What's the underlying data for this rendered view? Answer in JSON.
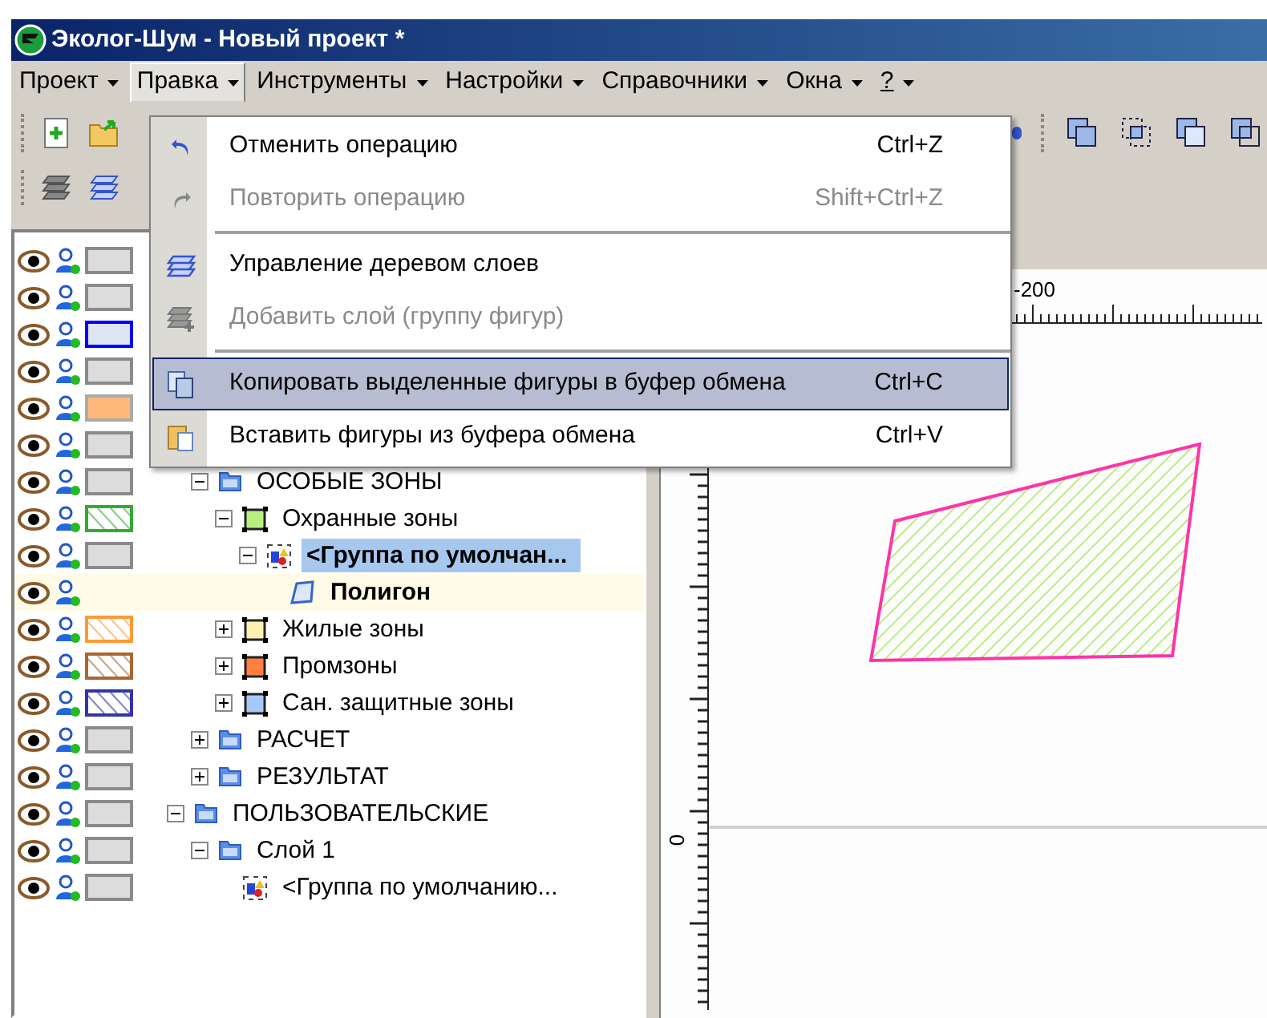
{
  "window": {
    "title": "Эколог-Шум - Новый проект *"
  },
  "menu_bar": [
    {
      "label": "Проект",
      "selected": false
    },
    {
      "label": "Правка",
      "selected": true
    },
    {
      "label": "Инструменты",
      "selected": false
    },
    {
      "label": "Настройки",
      "selected": false
    },
    {
      "label": "Справочники",
      "selected": false
    },
    {
      "label": "Окна",
      "selected": false
    },
    {
      "label": "?",
      "selected": false
    }
  ],
  "dropdown_menu": [
    {
      "kind": "undo",
      "label": "Отменить операцию",
      "shortcut": "Ctrl+Z",
      "disabled": false,
      "selected": false
    },
    {
      "kind": "redo",
      "label": "Повторить операцию",
      "shortcut": "Shift+Ctrl+Z",
      "disabled": true,
      "selected": false
    },
    {
      "kind": "separator"
    },
    {
      "kind": "layers",
      "label": "Управление деревом слоев",
      "disabled": false,
      "selected": false
    },
    {
      "kind": "add-layer",
      "label": "Добавить слой (группу фигур)",
      "disabled": true,
      "selected": false
    },
    {
      "kind": "separator"
    },
    {
      "kind": "copy",
      "label": "Копировать выделенные фигуры в буфер обмена",
      "shortcut": "Ctrl+C",
      "disabled": false,
      "selected": true
    },
    {
      "kind": "paste",
      "label": "Вставить фигуры из буфера обмена",
      "shortcut": "Ctrl+V",
      "disabled": false,
      "selected": false
    }
  ],
  "layers": [
    {
      "kind": "plain",
      "highlighted": false
    },
    {
      "kind": "plain",
      "highlighted": false
    },
    {
      "kind": "outline",
      "color": "#0000ff",
      "highlighted": false
    },
    {
      "kind": "plain",
      "highlighted": false
    },
    {
      "kind": "filled",
      "color": "#ffb878",
      "highlighted": false
    },
    {
      "kind": "plain",
      "highlighted": false
    },
    {
      "kind": "plain",
      "highlighted": false
    },
    {
      "kind": "hatched",
      "color": "#33aa33",
      "highlighted": false
    },
    {
      "kind": "plain",
      "highlighted": false
    },
    {
      "kind": "none",
      "highlighted": true
    },
    {
      "kind": "hatched",
      "color": "#ff9933",
      "highlighted": false
    },
    {
      "kind": "hatched",
      "color": "#aa6633",
      "highlighted": false
    },
    {
      "kind": "hatched",
      "color": "#3333aa",
      "highlighted": false
    },
    {
      "kind": "plain",
      "highlighted": false
    },
    {
      "kind": "plain",
      "highlighted": false
    },
    {
      "kind": "plain",
      "highlighted": false
    },
    {
      "kind": "plain",
      "highlighted": false
    },
    {
      "kind": "plain",
      "highlighted": false
    }
  ],
  "tree": [
    {
      "children": [
        {
          "label": "ОСОБЫЕ ЗОНЫ",
          "kind": "folder",
          "expanded": true,
          "selected": false,
          "active": false,
          "children": [
            {
              "label": "Охранные зоны",
              "kind": "zone",
              "color": "#b8f080",
              "expanded": true,
              "selected": false,
              "active": false,
              "children": [
                {
                  "label": "<Группа по умолчан...",
                  "kind": "group",
                  "expanded": true,
                  "selected": true,
                  "active": false,
                  "children": [
                    {
                      "label": "Полигон",
                      "kind": "polygon",
                      "selected": false,
                      "active": true
                    }
                  ]
                }
              ]
            },
            {
              "label": "Жилые зоны",
              "kind": "zone",
              "color": "#fff0b0",
              "expanded": false,
              "selected": false,
              "active": false
            },
            {
              "label": "Промзоны",
              "kind": "zone",
              "color": "#ff8040",
              "expanded": false,
              "selected": false,
              "active": false
            },
            {
              "label": "Сан. защитные зоны",
              "kind": "zone",
              "color": "#a8c8f8",
              "expanded": false,
              "selected": false,
              "active": false
            }
          ]
        },
        {
          "label": "РАСЧЕТ",
          "kind": "folder",
          "expanded": false,
          "selected": false,
          "active": false
        },
        {
          "label": "РЕЗУЛЬТАТ",
          "kind": "folder",
          "expanded": false,
          "selected": false,
          "active": false
        }
      ]
    },
    {
      "label": "ПОЛЬЗОВАТЕЛЬСКИЕ",
      "kind": "folder",
      "expanded": true,
      "selected": false,
      "active": false,
      "children": [
        {
          "label": "Слой 1",
          "kind": "folder",
          "expanded": true,
          "selected": false,
          "active": false,
          "children": [
            {
              "label": "<Группа по умолчанию...",
              "kind": "group",
              "selected": false,
              "active": false
            }
          ]
        }
      ]
    }
  ],
  "canvas": {
    "ruler_top_label": "-200",
    "ruler_left_label": "0"
  }
}
